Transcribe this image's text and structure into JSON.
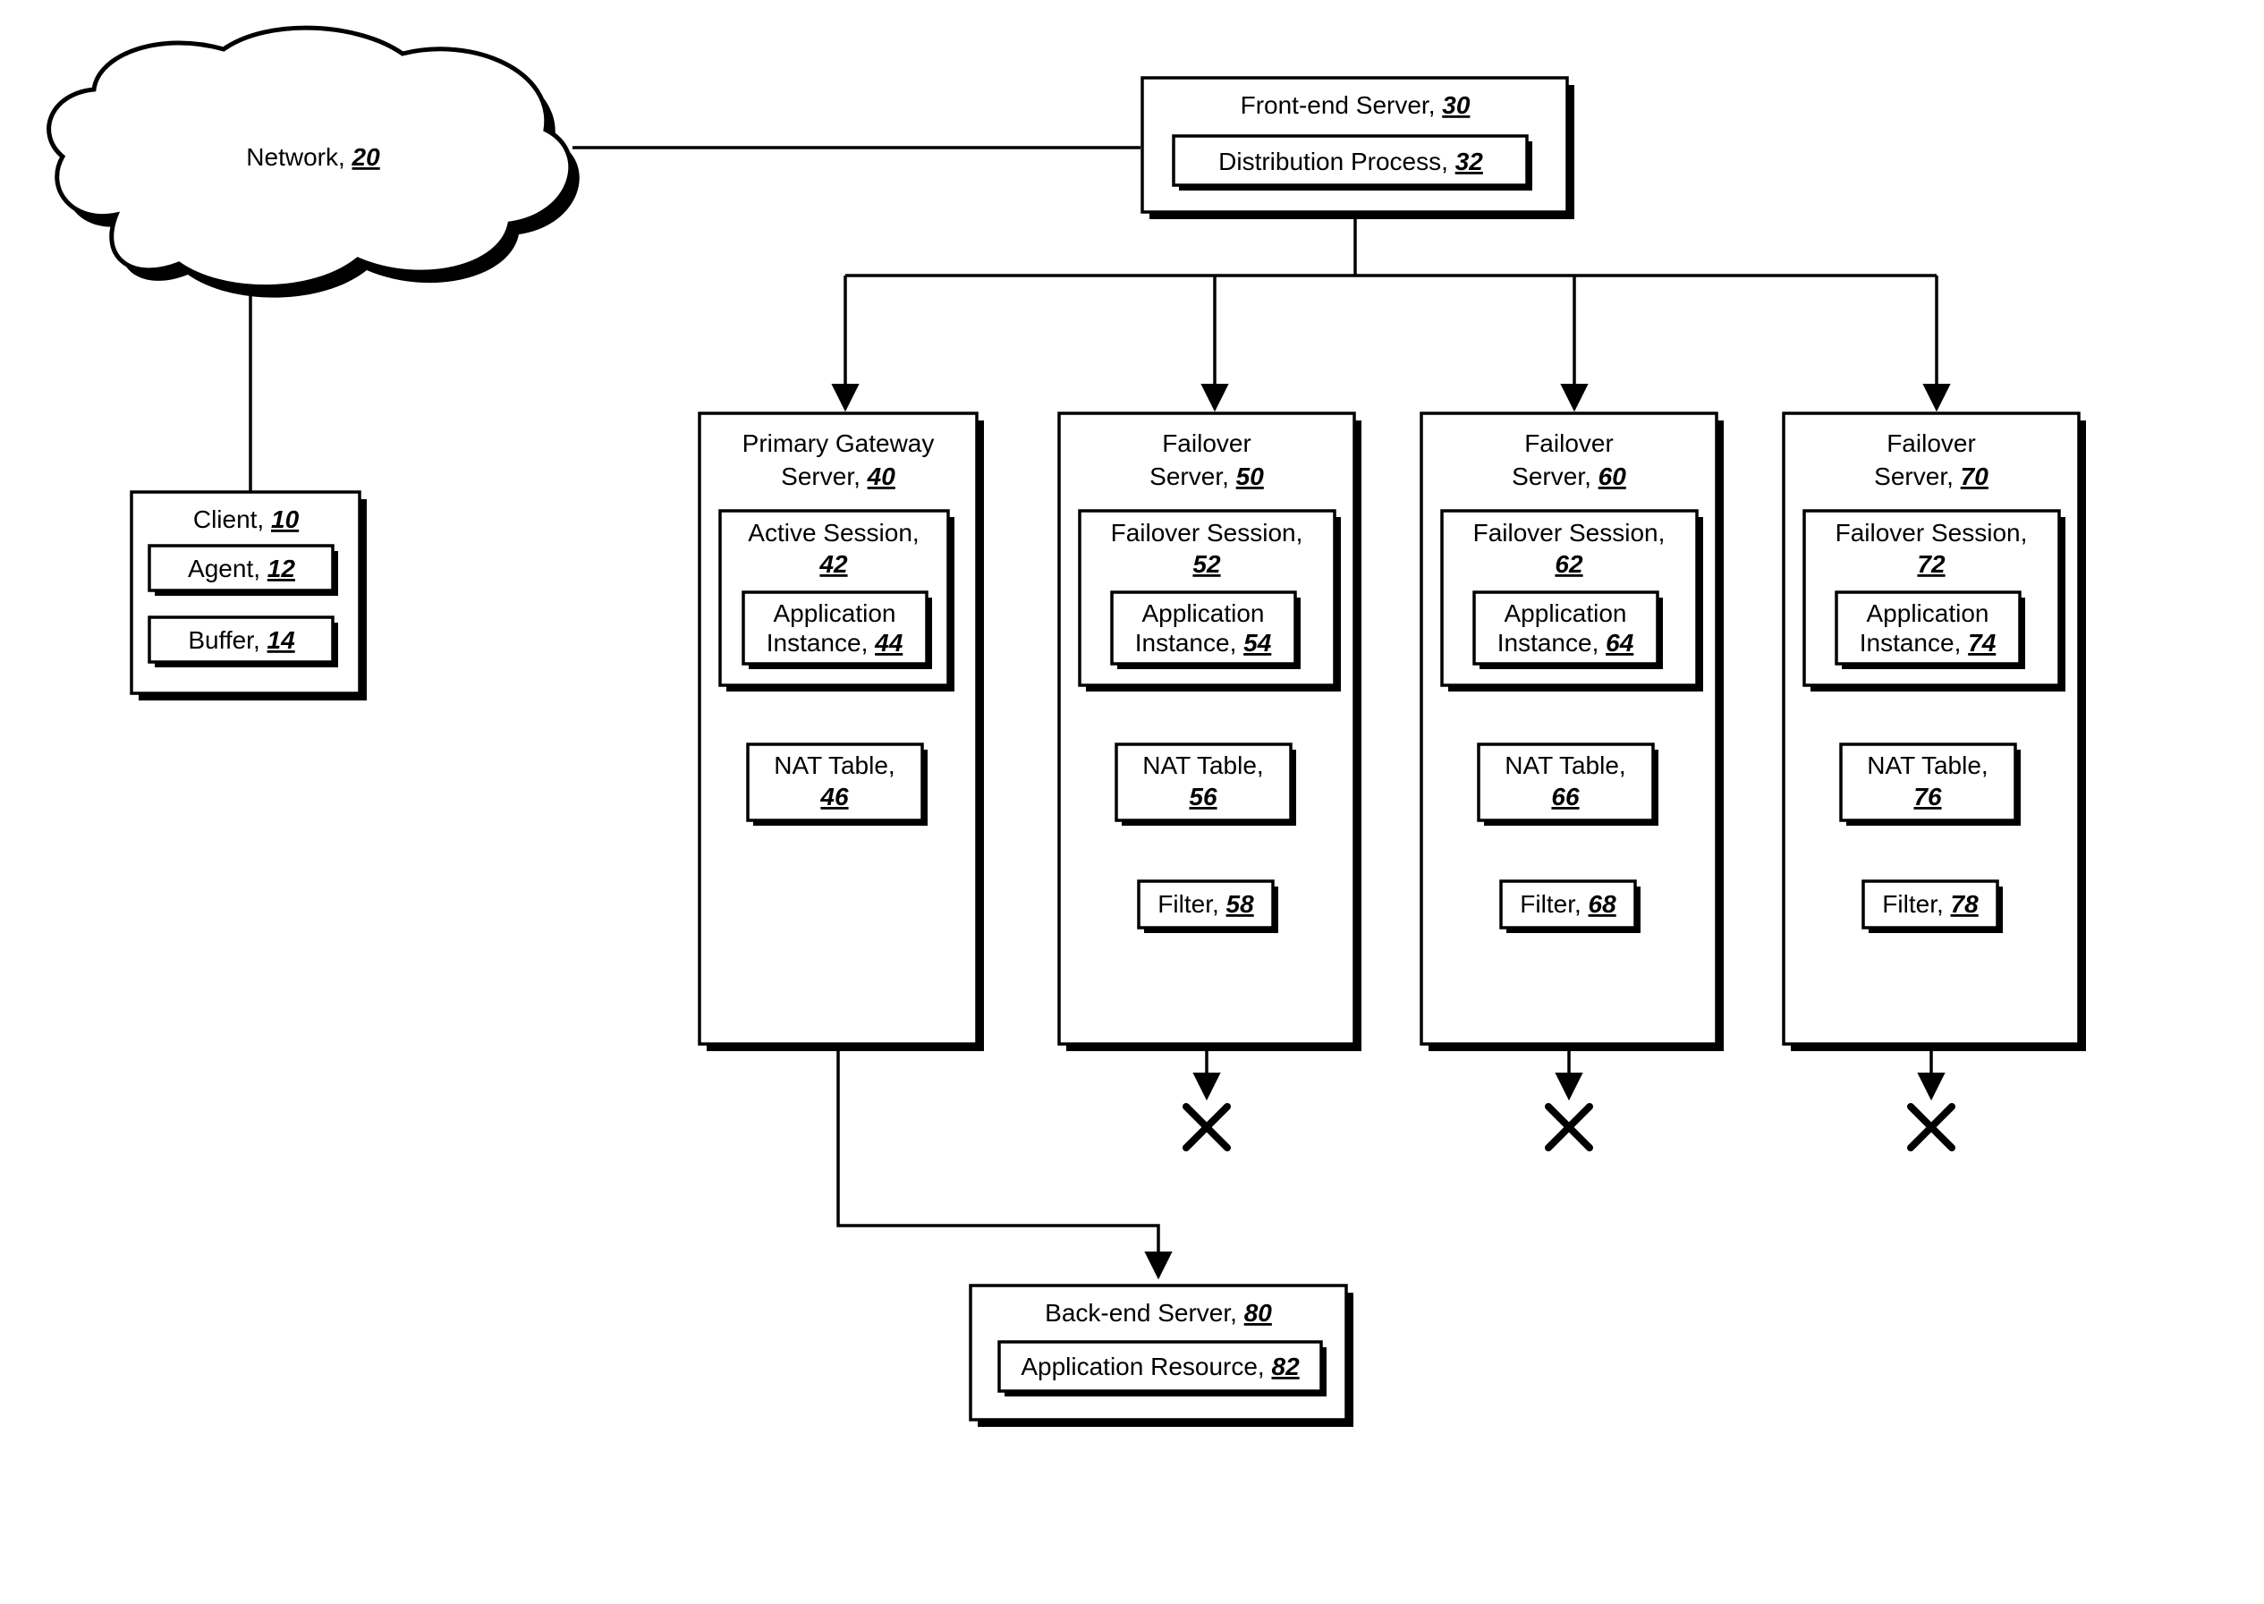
{
  "network": {
    "label": "Network, ",
    "ref": "20"
  },
  "client": {
    "label": "Client, ",
    "ref": "10",
    "agent": {
      "label": "Agent, ",
      "ref": "12"
    },
    "buffer": {
      "label": "Buffer, ",
      "ref": "14"
    }
  },
  "frontend": {
    "label": "Front-end Server, ",
    "ref": "30",
    "dist": {
      "label": "Distribution Process, ",
      "ref": "32"
    }
  },
  "primary": {
    "title1": "Primary Gateway",
    "title2": "Server, ",
    "ref": "40",
    "session": {
      "label": "Active Session,",
      "ref": "42"
    },
    "app": {
      "line1": "Application",
      "line2": "Instance, ",
      "ref": "44"
    },
    "nat": {
      "label": "NAT Table,",
      "ref": "46"
    }
  },
  "fail50": {
    "title1": "Failover",
    "title2": "Server, ",
    "ref": "50",
    "session": {
      "label": "Failover Session,",
      "ref": "52"
    },
    "app": {
      "line1": "Application",
      "line2": "Instance, ",
      "ref": "54"
    },
    "nat": {
      "label": "NAT Table,",
      "ref": "56"
    },
    "filter": {
      "label": "Filter, ",
      "ref": "58"
    }
  },
  "fail60": {
    "title1": "Failover",
    "title2": "Server, ",
    "ref": "60",
    "session": {
      "label": "Failover Session,",
      "ref": "62"
    },
    "app": {
      "line1": "Application",
      "line2": "Instance, ",
      "ref": "64"
    },
    "nat": {
      "label": "NAT Table,",
      "ref": "66"
    },
    "filter": {
      "label": "Filter, ",
      "ref": "68"
    }
  },
  "fail70": {
    "title1": "Failover",
    "title2": "Server, ",
    "ref": "70",
    "session": {
      "label": "Failover Session,",
      "ref": "72"
    },
    "app": {
      "line1": "Application",
      "line2": "Instance, ",
      "ref": "74"
    },
    "nat": {
      "label": "NAT Table,",
      "ref": "76"
    },
    "filter": {
      "label": "Filter, ",
      "ref": "78"
    }
  },
  "backend": {
    "label": "Back-end Server, ",
    "ref": "80",
    "res": {
      "label": "Application Resource, ",
      "ref": "82"
    }
  }
}
